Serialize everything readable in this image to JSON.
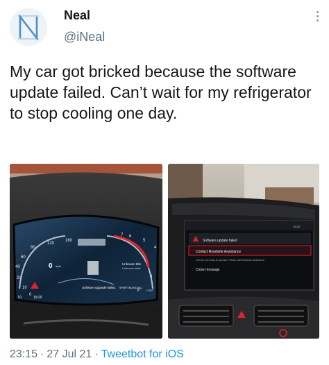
{
  "user": {
    "display_name": "Neal",
    "handle": "@iNeal",
    "avatar_icon": "n-logo-avatar"
  },
  "tweet": {
    "text": "My car got bricked because the software update failed. Can’t wait for my refrigerator to stop cooling one day."
  },
  "photo_1": {
    "gauge_120": "120",
    "gauge_160": "160",
    "gauge_80": "80",
    "gauge_60": "60",
    "gauge_40": "40",
    "gauge_20": "20",
    "gauge_10": "10",
    "gauge_0": "0",
    "gauge_5": "5",
    "gauge_6": "6",
    "gauge_7": "7",
    "gauge_4": "4",
    "gauge_3": "3",
    "speed_value": "0",
    "speed_unit": "mph",
    "unknown_title": "Unknown title",
    "unknown_artist": "Unknown artist",
    "warning_text": "Software upgrade failed.",
    "mode": "SPORT INDIVIDUAL",
    "gear": "P",
    "temperature": "+73°F",
    "mileage": "91",
    "time": "19:20"
  },
  "photo_2": {
    "alert_title": "Software update failed",
    "menu_item_1": "Contact Roadside Assistance",
    "detail_text": "Vehicle not ready-to-operate. Please call Roadside Assistance.",
    "menu_item_2": "Close message",
    "clock": "19:20"
  },
  "meta": {
    "time": "23:15",
    "separator_1": "·",
    "date": "27 Jul 21",
    "separator_2": "·",
    "client": "Tweetbot for iOS"
  },
  "colors": {
    "handle": "#5b7083",
    "link": "#1b95e0",
    "warning": "#e0242a"
  }
}
